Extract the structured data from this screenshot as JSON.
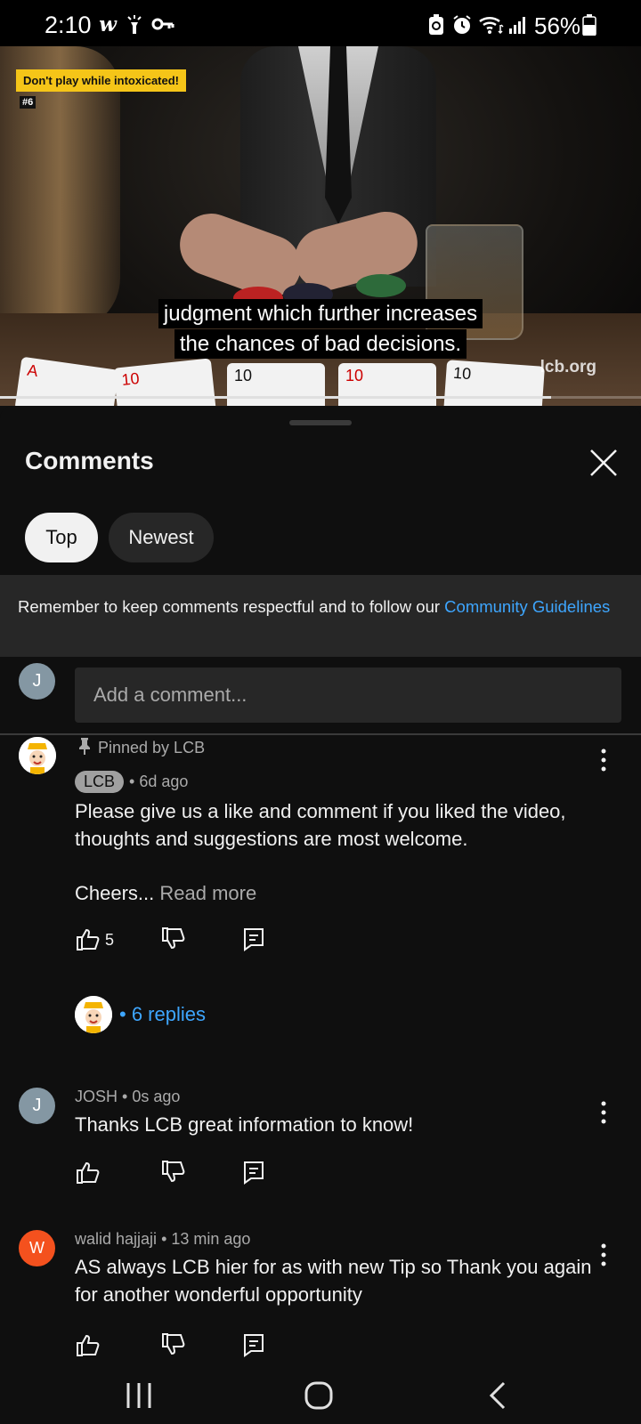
{
  "status_bar": {
    "time": "2:10",
    "battery_text": "56%",
    "left_icons": [
      "w-app-icon",
      "flashlight-icon",
      "key-icon"
    ],
    "right_icons": [
      "battery-saver-icon",
      "alarm-icon",
      "wifi-icon",
      "signal-icon",
      "battery-icon"
    ]
  },
  "video": {
    "warning_label": "Don't play while intoxicated!",
    "warning_number": "#6",
    "caption_lines": [
      "judgment which further increases",
      "the chances of bad decisions."
    ],
    "watermark": "lcb.org",
    "progress": 0.86
  },
  "comments_panel": {
    "title": "Comments",
    "filters": {
      "top": "Top",
      "newest": "Newest",
      "selected": "Top"
    },
    "guidelines": {
      "text": "Remember to keep comments respectful and to follow our ",
      "link": "Community Guidelines"
    },
    "add_comment": {
      "avatar_letter": "J",
      "placeholder": "Add a comment..."
    },
    "comments": [
      {
        "pinned_label": "Pinned by LCB",
        "author": "LCB",
        "time": "6d ago",
        "lines": [
          "Please give us a like and comment if you liked the video,",
          "thoughts and suggestions are most welcome."
        ],
        "cheers": "Cheers...",
        "read_more": "Read more",
        "likes": "5",
        "replies": "6 replies"
      },
      {
        "author": "JOSH",
        "avatar_letter": "J",
        "time": "0s ago",
        "lines": [
          "Thanks LCB great information to know!"
        ]
      },
      {
        "author": "walid hajjaji",
        "avatar_letter": "W",
        "time": "13 min ago",
        "lines": [
          "AS always LCB hier for as with new Tip so Thank you again",
          "for another wonderful opportunity"
        ]
      }
    ]
  },
  "colors": {
    "background": "#0f0f0f",
    "surface": "#272727",
    "link": "#3ea6ff",
    "secondary_text": "#aaaaaa",
    "warning": "#f5c518",
    "avatar_josh": "#8497a3",
    "avatar_walid": "#f4511e"
  }
}
